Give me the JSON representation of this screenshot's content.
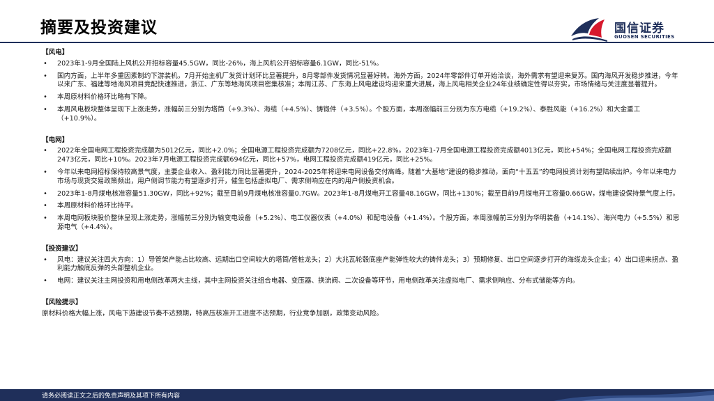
{
  "page": {
    "title": "摘要及投资建议"
  },
  "logo": {
    "name_cn": "国信证券",
    "name_en": "GUOSEN SECURITIES",
    "colors": {
      "navy": "#1f2f5a",
      "red": "#d7192d"
    }
  },
  "sections": {
    "wind": {
      "heading": "【风电】",
      "items": [
        "2023年1-9月全国陆上风机公开招标容量45.5GW，同比-26%，海上风机公开招标容量6.1GW，同比-51%。",
        "国内方面，上半年多重因素制约下游装机，7月开始主机厂发货计划环比显著提升，8月零部件发货情况显著好转。海外方面，2024年零部件订单开始洽谈，海外需求有望迎来复苏。国内海风开发稳步推进，今年以来广东、福建等地海风项目竞配快速推进，浙江、广东等地海风项目密集核准；本周江苏、广东海上风电建设均迎来重大进展，海上风电相关企业24年业绩确定性得以夯实，市场情绪与关注度显著提升。",
        "本周原材料价格环比略有下降。",
        "本周风电板块整体呈现下上涨走势，涨幅前三分别为塔筒（+9.3%）、海缆（+4.5%）、铸锻件（+3.5%）。个股方面，本周涨幅前三分别为东方电缆（+19.2%）、泰胜风能（+16.2%）和大金重工（+10.9%）。"
      ]
    },
    "grid": {
      "heading": "【电网】",
      "items": [
        "2022年全国电网工程投资完成额为5012亿元，同比+2.0%；全国电源工程投资完成额为7208亿元，同比+22.8%。2023年1-7月全国电源工程投资完成额4013亿元，同比+54%；全国电网工程投资完成额2473亿元，同比+10%。2023年7月电源工程投资完成额694亿元，同比+57%，电网工程投资完成额419亿元，同比+25%。",
        "今年以来电网招标保持较高景气度，主要企业收入、盈利能力同比显著提升，2024-2025年将迎来电网设备交付高峰。随着“大基地”建设的稳步推动，面向“十五五”的电网投资计划有望陆续出炉。今年以来电力市场与现货交易政策频出，用户侧调节能力有望逐步打开，催生包括虚拟电厂、需求侧响应在内的用户侧投资机会。",
        "2023年1-8月煤电核准容量51.30GW，同比+92%；截至目前9月煤电核准容量0.7GW。2023年1-8月煤电开工容量48.16GW，同比+130%；截至目前9月煤电开工容量0.66GW，煤电建设保持景气度上行。",
        "本周原材料价格环比持平。",
        "本周电网板块股价整体呈现上涨走势，涨幅前三分别为输变电设备（+5.2%）、电工仪器仪表（+4.0%）和配电设备（+1.4%）。个股方面，本周涨幅前三分别为华明装备（+14.1%）、海兴电力（+5.5%）和思源电气（+4.4%）。"
      ]
    },
    "invest": {
      "heading": "【投资建议】",
      "items": [
        "风电：建议关注四大方向：1）导管架产能占比较高、远期出口空间较大的塔筒/管桩龙头；2）大兆瓦轮毂底座产能弹性较大的铸件龙头；3）预期修复、出口空间逐步打开的海缆龙头企业；4）出口迎来拐点、盈利能力触底反弹的头部整机企业。",
        "电网：建议关注主网投资和用电侧改革两大主线，其中主网投资关注组合电器、变压器、换流阀、二次设备等环节，用电侧改革关注虚拟电厂、需求侧响应、分布式储能等方向。"
      ]
    },
    "risk": {
      "heading": "【风险提示】",
      "text": "原材料价格大幅上涨，风电下游建设节奏不达预期，特高压核准开工进度不达预期，行业竞争加剧，政策变动风险。"
    }
  },
  "footer": {
    "disclaimer": "请务必阅读正文之后的免责声明及其项下所有内容"
  },
  "bullet_glyph": "•"
}
